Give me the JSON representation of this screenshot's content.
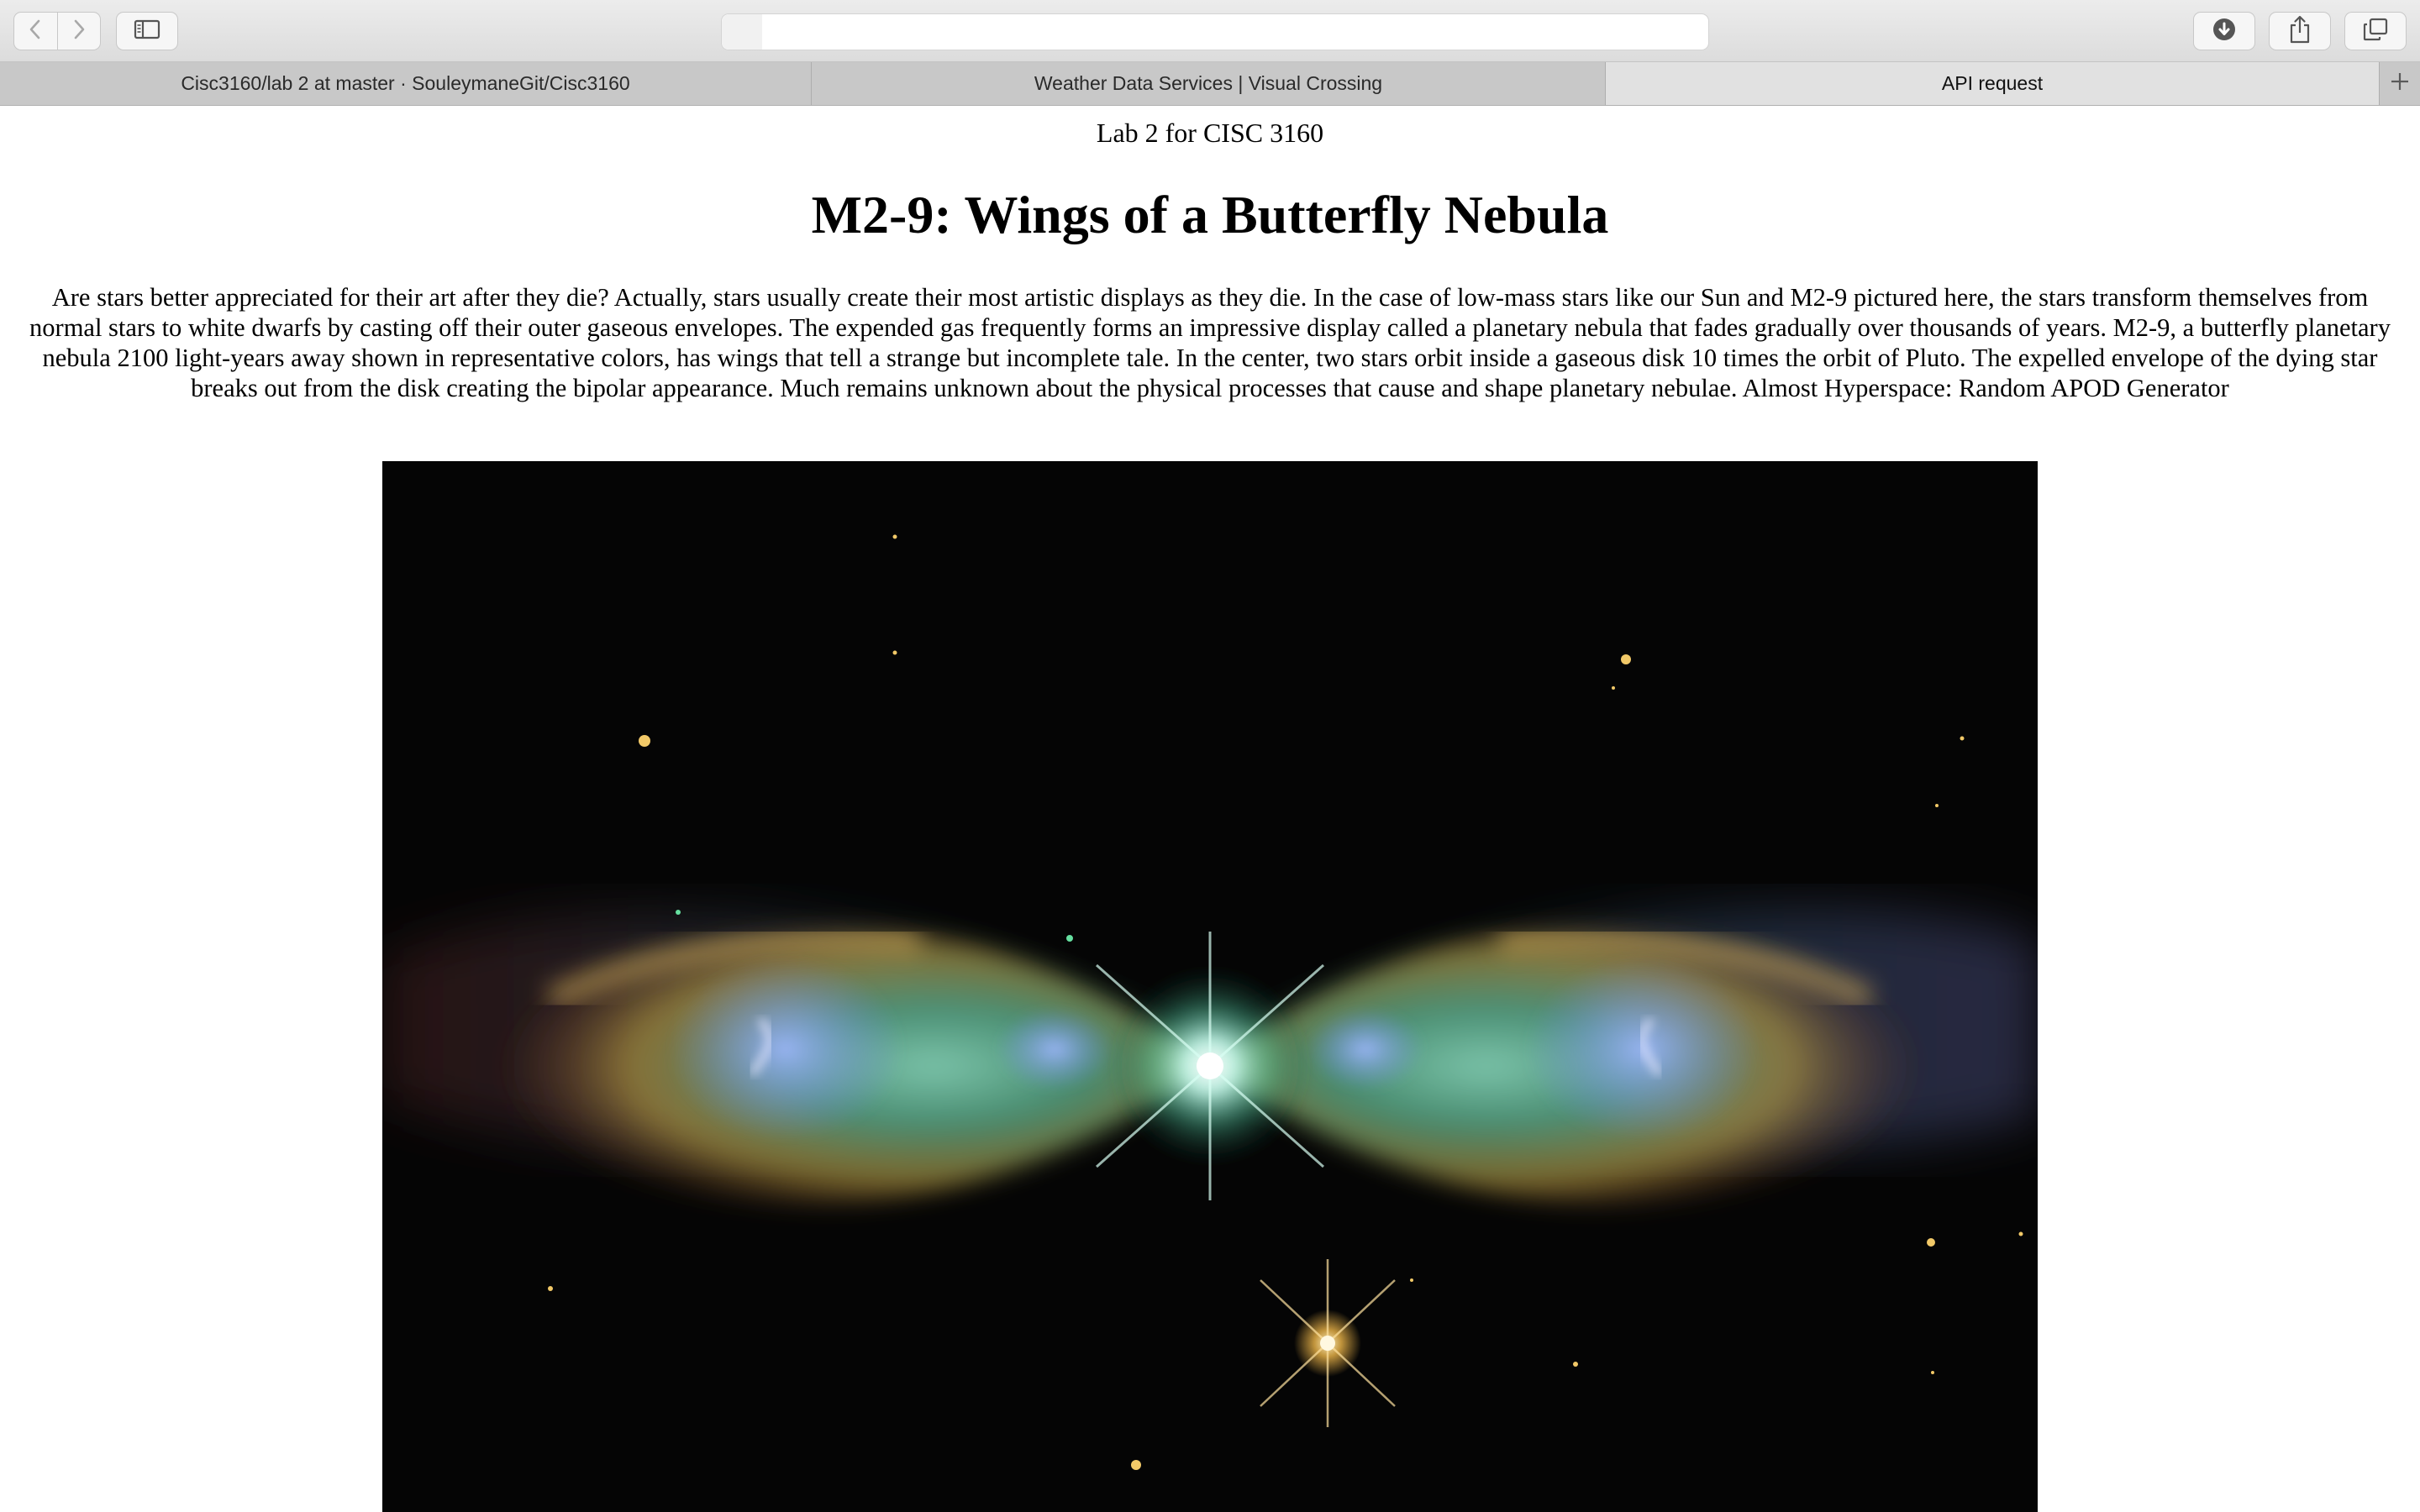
{
  "browser": {
    "address_value": "",
    "toolbar_icons": {
      "back": "chevron-left-icon",
      "forward": "chevron-right-icon",
      "sidebar": "sidebar-icon",
      "downloads": "download-icon",
      "share": "share-icon",
      "tabs_overview": "tabs-overview-icon"
    },
    "tabs": [
      {
        "label": "Cisc3160/lab 2 at master · SouleymaneGit/Cisc3160",
        "active": false
      },
      {
        "label": "Weather Data Services | Visual Crossing",
        "active": false
      },
      {
        "label": "API request",
        "active": true
      }
    ],
    "new_tab_icon": "plus-icon"
  },
  "page": {
    "header": "Lab 2 for CISC 3160",
    "title": "M2-9: Wings of a Butterfly Nebula",
    "explanation": "Are stars better appreciated for their art after they die? Actually, stars usually create their most artistic displays as they die. In the case of low-mass stars like our Sun and M2-9 pictured here, the stars transform themselves from normal stars to white dwarfs by casting off their outer gaseous envelopes. The expended gas frequently forms an impressive display called a planetary nebula that fades gradually over thousands of years. M2-9, a butterfly planetary nebula 2100 light-years away shown in representative colors, has wings that tell a strange but incomplete tale. In the center, two stars orbit inside a gaseous disk 10 times the orbit of Pluto. The expelled envelope of the dying star breaks out from the disk creating the bipolar appearance. Much remains unknown about the physical processes that cause and shape planetary nebulae. Almost Hyperspace: Random APOD Generator"
  },
  "colors": {
    "toolbar_bg": "#dcdcdc",
    "tab_bg": "#c8c8c8",
    "active_tab_bg": "#e1e1e1",
    "image_bg": "#050505"
  }
}
